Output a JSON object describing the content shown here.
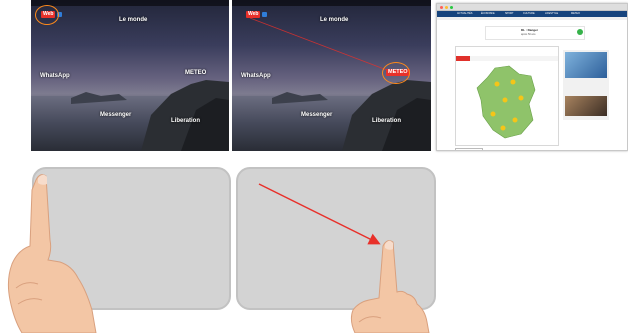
{
  "left_screen": {
    "labels": {
      "le_monde": "Le monde",
      "whatsapp": "WhatsApp",
      "meteo": "METEO",
      "messenger": "Messenger",
      "liberation": "Liberation"
    },
    "badge": "Web"
  },
  "right_screen": {
    "labels": {
      "le_monde": "Le monde",
      "whatsapp": "WhatsApp",
      "meteo": "METEO",
      "messenger": "Messenger",
      "liberation": "Liberation"
    },
    "badge": "Web"
  },
  "browser": {
    "ad_title": "DL : Danger",
    "ad_text": "après 50 ans",
    "nav_items": [
      "ACTUALITÉS",
      "ÉCONOMIE",
      "SPORT",
      "CULTURE",
      "LIFESTYLE",
      "METEO"
    ]
  },
  "colors": {
    "accent_red": "#e8302a",
    "ring_orange": "#ff8a1a",
    "arrow_red": "#e8302a",
    "trackpad": "#d3d3d3"
  },
  "icons": {
    "pointer_circle": "ring",
    "gesture_arrow": "arrow"
  }
}
